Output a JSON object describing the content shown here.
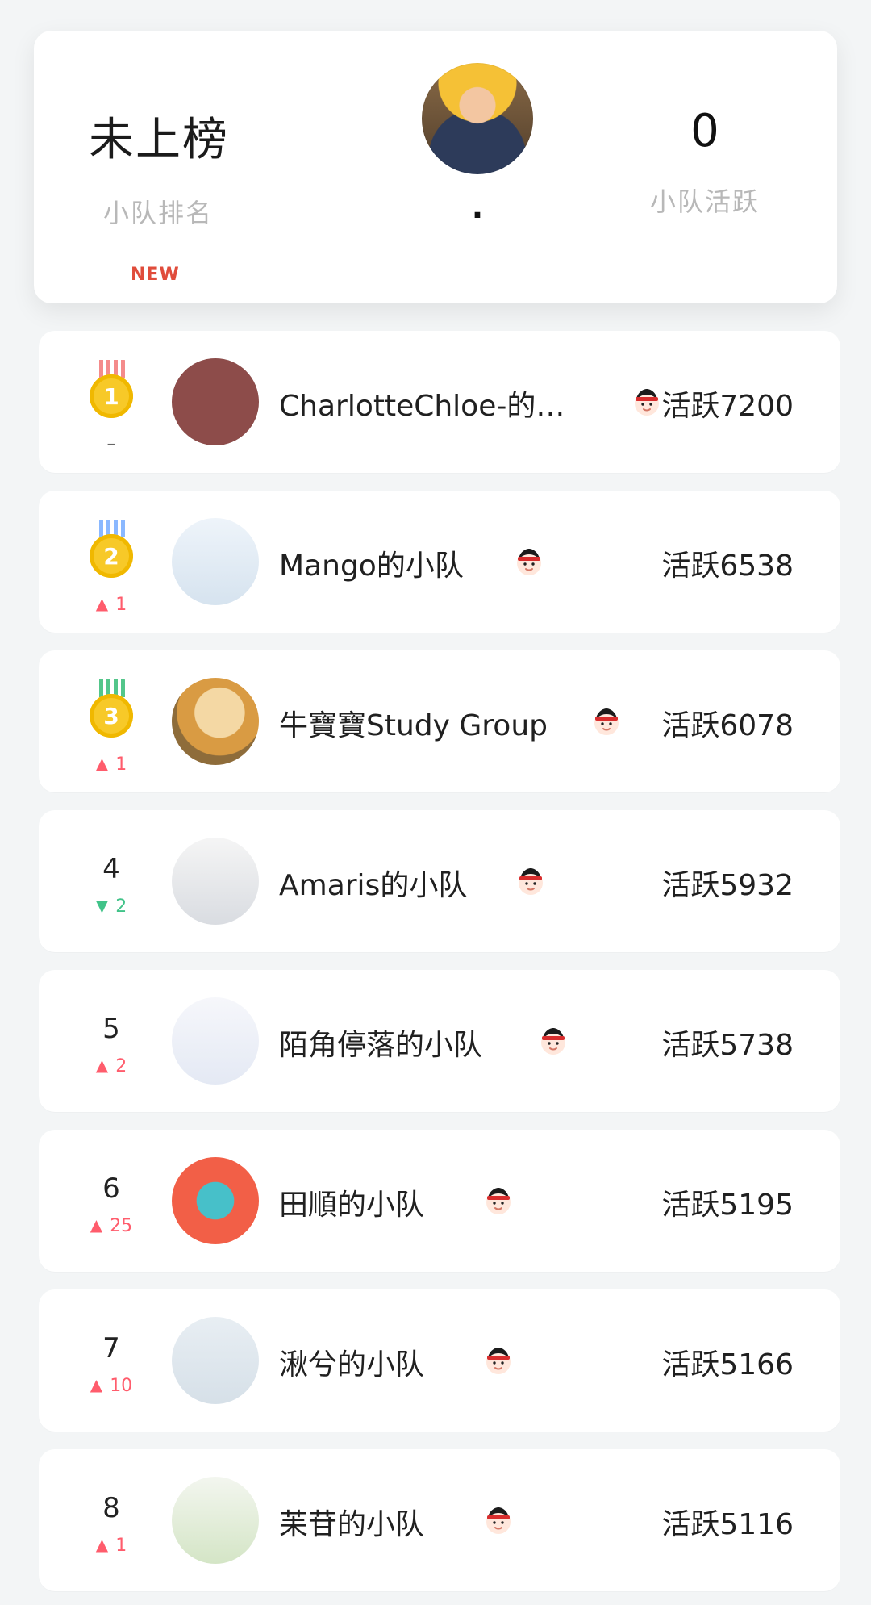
{
  "summary": {
    "rank_status": "未上榜",
    "rank_label": "小队排名",
    "new_badge": "NEW",
    "center_name": ".",
    "activity_value": "0",
    "activity_label": "小队活跃"
  },
  "icons": {
    "leader": "leader-icon",
    "medal_gold": "gold-medal-icon"
  },
  "rows": [
    {
      "rank": "1",
      "change": "–",
      "change_type": "neutral",
      "name": "CharlotteChloe-的…",
      "score": "活跃7200",
      "medal_color": "#f48b8b"
    },
    {
      "rank": "2",
      "change": "1",
      "change_type": "up",
      "name": "Mango的小队",
      "score": "活跃6538",
      "medal_color": "#8ab8ff"
    },
    {
      "rank": "3",
      "change": "1",
      "change_type": "up",
      "name": "牛寶寶Study Group",
      "score": "活跃6078",
      "medal_color": "#53c68a"
    },
    {
      "rank": "4",
      "change": "2",
      "change_type": "down",
      "name": "Amaris的小队",
      "score": "活跃5932"
    },
    {
      "rank": "5",
      "change": "2",
      "change_type": "up",
      "name": "陌角停落的小队",
      "score": "活跃5738"
    },
    {
      "rank": "6",
      "change": "25",
      "change_type": "up",
      "name": "田順的小队",
      "score": "活跃5195"
    },
    {
      "rank": "7",
      "change": "10",
      "change_type": "up",
      "name": "湫兮的小队",
      "score": "活跃5166"
    },
    {
      "rank": "8",
      "change": "1",
      "change_type": "up",
      "name": "苿苷的小队",
      "score": "活跃5116"
    }
  ]
}
